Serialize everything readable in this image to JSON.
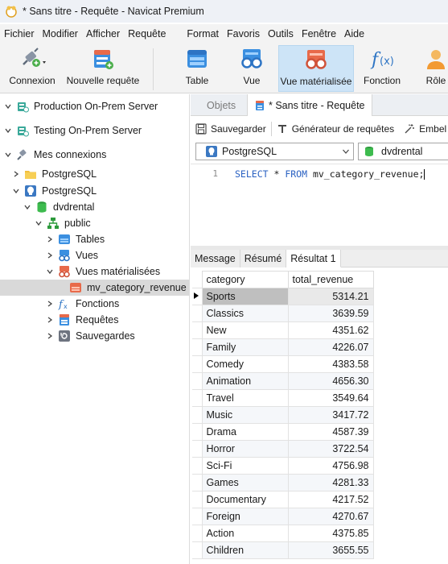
{
  "window": {
    "title": "* Sans titre - Requête - Navicat Premium"
  },
  "menu": [
    "Fichier",
    "Modifier",
    "Afficher",
    "Requête",
    "Format",
    "Favoris",
    "Outils",
    "Fenêtre",
    "Aide"
  ],
  "toolbar": {
    "connexion": "Connexion",
    "nouvelle_requete": "Nouvelle requête",
    "table": "Table",
    "vue": "Vue",
    "vue_materialisee": "Vue matérialisée",
    "fonction": "Fonction",
    "role": "Rôle"
  },
  "tree": {
    "production": "Production On-Prem Server",
    "testing": "Testing On-Prem Server",
    "mes_connexions": "Mes connexions",
    "pg1": "PostgreSQL",
    "pg2": "PostgreSQL",
    "db": "dvdrental",
    "schema": "public",
    "tables": "Tables",
    "vues": "Vues",
    "vues_mat": "Vues matérialisées",
    "mv_item": "mv_category_revenue",
    "fonctions": "Fonctions",
    "requetes": "Requêtes",
    "sauvegardes": "Sauvegardes"
  },
  "tabs": {
    "objets": "Objets",
    "query": "* Sans titre - Requête"
  },
  "query_toolbar": {
    "save": "Sauvegarder",
    "builder": "Générateur de requêtes",
    "beautify": "Embel"
  },
  "selectors": {
    "connection": "PostgreSQL",
    "database": "dvdrental"
  },
  "editor": {
    "line": "1",
    "kw1": "SELECT",
    "star": " * ",
    "kw2": "FROM",
    "rest": " mv_category_revenue;"
  },
  "result_tabs": {
    "message": "Message",
    "resume": "Résumé",
    "resultat": "Résultat 1"
  },
  "results": {
    "columns": [
      "category",
      "total_revenue"
    ],
    "rows": [
      [
        "Sports",
        "5314.21"
      ],
      [
        "Classics",
        "3639.59"
      ],
      [
        "New",
        "4351.62"
      ],
      [
        "Family",
        "4226.07"
      ],
      [
        "Comedy",
        "4383.58"
      ],
      [
        "Animation",
        "4656.30"
      ],
      [
        "Travel",
        "3549.64"
      ],
      [
        "Music",
        "3417.72"
      ],
      [
        "Drama",
        "4587.39"
      ],
      [
        "Horror",
        "3722.54"
      ],
      [
        "Sci-Fi",
        "4756.98"
      ],
      [
        "Games",
        "4281.33"
      ],
      [
        "Documentary",
        "4217.52"
      ],
      [
        "Foreign",
        "4270.67"
      ],
      [
        "Action",
        "4375.85"
      ],
      [
        "Children",
        "3655.55"
      ]
    ]
  },
  "colors": {
    "accent": "#2a61c2",
    "active_toolbar": "#cde4f7",
    "selected_row": "#d9d9d9"
  }
}
